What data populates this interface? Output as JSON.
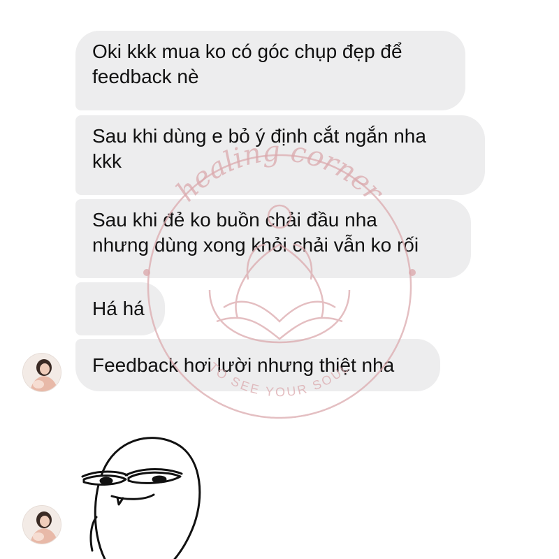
{
  "conversation": {
    "messages": [
      {
        "text": "Oki kkk mua ko có góc chụp đẹp để\nfeedback nè"
      },
      {
        "text": "Sau khi dùng e bỏ ý định cắt ngắn nha\nkkk"
      },
      {
        "text": "Sau khi đẻ ko buồn chải đầu nha\nnhưng dùng xong khỏi chải vẫn ko rối"
      },
      {
        "text": "Há há"
      },
      {
        "text": "Feedback hơi lười nhưng thiệt nha"
      }
    ],
    "sticker": {
      "icon": "smirking-face-sticker"
    }
  },
  "watermark": {
    "arc_text": "healing corner",
    "bottom_text": "TO SEE YOUR SOUL",
    "color": "#dba9ad"
  },
  "colors": {
    "bubble_bg": "#ededee",
    "text": "#111111",
    "background": "#ffffff"
  }
}
